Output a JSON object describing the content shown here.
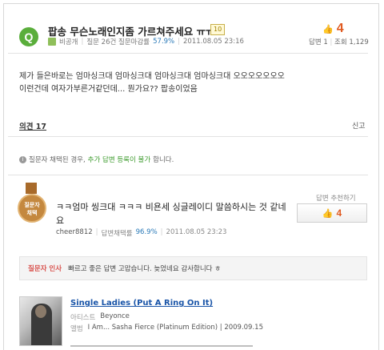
{
  "question": {
    "badge": "Q",
    "title": "팝송 무슨노래인지좀 가르쳐주세요 ㅠㅠ",
    "points": "10",
    "author": "비공개",
    "meta_rate_label": "질문 26건 질문마감률",
    "meta_rate": "57.9%",
    "date": "2011.08.05 23:16",
    "likes": "4",
    "answers_label": "답변",
    "answers": "1",
    "views_label": "조회",
    "views": "1,129",
    "body_line1": "제가 들은바로는 엄마싱크대 엄마싱크대 엄마싱크대 엄마싱크대 오오오오오오오",
    "body_line2": "이런건데 여자가부른거같던데... 뭔가요?? 팝송이었음",
    "opinion_label": "의견 17",
    "report_label": "신고",
    "notice_prefix": "질문자 채택된 경우,",
    "notice_highlight": "추가 답변 등록이 불가",
    "notice_suffix": "합니다."
  },
  "answer": {
    "medal_line1": "질문자",
    "medal_line2": "채택",
    "text": "ㅋㅋ엄마 씽크대 ㅋㅋㅋ 비욘세 싱글레이디 말씀하시는 것 같네요",
    "user": "cheer8812",
    "rate_label": "답변채택률",
    "rate": "96.9%",
    "date": "2011.08.05 23:23",
    "recommend_label": "답변 추천하기",
    "recommend_count": "4",
    "thanks_label": "질문자 인사",
    "thanks_text": "빠르고 좋은 답변 고맙습니다. 늦었네요 감사합니다 ㅎ"
  },
  "music": {
    "title": "Single Ladies (Put A Ring On It)",
    "artist_label": "아티스트",
    "artist": "Beyonce",
    "album_label": "앨범",
    "album": "I Am... Sasha Fierce (Platinum Edition) | 2009.09.15"
  },
  "colors": {
    "q_badge": "#5aae3b",
    "like": "#e05a20",
    "link": "#1a55a8",
    "medal": "#c4883f"
  }
}
